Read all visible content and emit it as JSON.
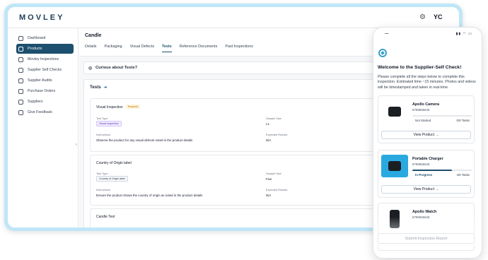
{
  "app": {
    "logo": "MOVLEY",
    "user_initials": "YC",
    "settings_icon": "gear-icon"
  },
  "sidebar": {
    "items": [
      {
        "label": "Dashboard",
        "icon": "grid-icon",
        "active": false
      },
      {
        "label": "Products",
        "icon": "box-icon",
        "active": true
      },
      {
        "label": "Movley Inspections",
        "icon": "search-icon",
        "active": false
      },
      {
        "label": "Supplier Self Checks",
        "icon": "checklist-icon",
        "active": false
      },
      {
        "label": "Supplier Audits",
        "icon": "building-icon",
        "active": false
      },
      {
        "label": "Purchase Orders",
        "icon": "document-icon",
        "active": false
      },
      {
        "label": "Suppliers",
        "icon": "users-icon",
        "active": false
      },
      {
        "label": "Give Feedback",
        "icon": "lightbulb-icon",
        "active": false
      }
    ]
  },
  "page": {
    "title": "Candle",
    "tabs": [
      "Details",
      "Packaging",
      "Visual Defects",
      "Tests",
      "Reference Documents",
      "Past Inspections"
    ],
    "active_tab": "Tests",
    "curious": "Curious about Tests?",
    "tests_heading": "Tests",
    "labels": {
      "test_type": "Test Type",
      "sample_size": "Sample Size",
      "instructions": "Instructions",
      "expected": "Expected Results"
    },
    "tests": [
      {
        "name": "Visual Inspection",
        "required": "Required",
        "type": "Visual Inspection",
        "sample": "L1",
        "instructions": "Observe the product for any visual defects noted in the product details",
        "expected": "N/A"
      },
      {
        "name": "Country of Origin label",
        "type": "Country of Origin label",
        "sample": "Five",
        "instructions": "Ensure the product shows the country of origin as noted in the product details",
        "expected": "N/A"
      },
      {
        "name": "Candle Test"
      }
    ]
  },
  "phone": {
    "welcome": "Welcome to the Supplier-Self Check!",
    "intro": "Please complete all the steps below to complete this inspection. Estimated time ~15 minutes. Photos and videos will be timestamped and taken in real-time.",
    "view_label": "View Product →",
    "products": [
      {
        "name": "Apollo Camera",
        "sku": "8799665645",
        "status": "Not Started",
        "tasks": "0/8 Tasks",
        "progress": 0.0
      },
      {
        "name": "Portable Charger",
        "sku": "8799665645",
        "status": "In Progress",
        "tasks": "4/6 Tasks",
        "progress": 0.67
      },
      {
        "name": "Apollo Watch",
        "sku": "8799665645"
      }
    ],
    "submit": "Submit Inspection Report"
  },
  "colors": {
    "primary": "#1d4f6e",
    "frame": "#bfe6f7",
    "accent": "#3aa0c8"
  }
}
